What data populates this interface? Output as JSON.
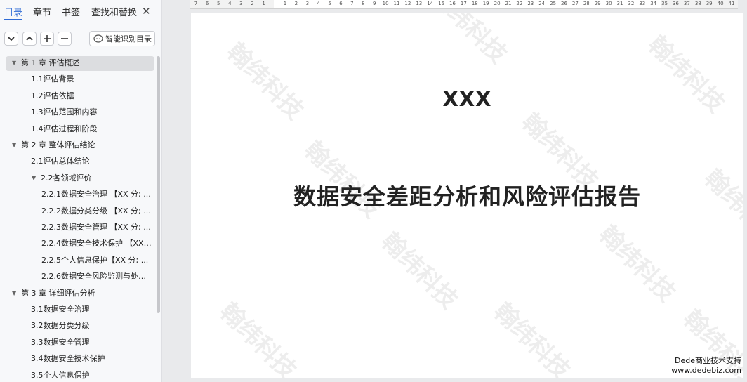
{
  "nav": {
    "tabs": [
      {
        "label": "目录",
        "active": true
      },
      {
        "label": "章节",
        "active": false
      },
      {
        "label": "书签",
        "active": false
      },
      {
        "label": "查找和替换",
        "active": false
      }
    ],
    "close_icon": "close-icon",
    "toolbar": {
      "collapse_icon": "chevron-down-icon",
      "expand_icon": "chevron-up-icon",
      "add_icon": "plus-icon",
      "remove_icon": "minus-icon",
      "smart_label": "智能识别目录"
    },
    "toc": [
      {
        "level": 1,
        "label": "第 1 章  评估概述",
        "collapsible": true,
        "selected": true
      },
      {
        "level": 2,
        "label": "1.1评估背景"
      },
      {
        "level": 2,
        "label": "1.2评估依据"
      },
      {
        "level": 2,
        "label": "1.3评估范围和内容"
      },
      {
        "level": 2,
        "label": "1.4评估过程和阶段"
      },
      {
        "level": 1,
        "label": "第 2 章  整体评估结论",
        "collapsible": true
      },
      {
        "level": 2,
        "label": "2.1评估总体结论"
      },
      {
        "level": 2,
        "label": "2.2各领域评价",
        "collapsible": true
      },
      {
        "level": 3,
        "label": "2.2.1数据安全治理 【XX 分; ..."
      },
      {
        "level": 3,
        "label": "2.2.2数据分类分级 【XX 分; ..."
      },
      {
        "level": 3,
        "label": "2.2.3数据安全管理 【XX 分; ..."
      },
      {
        "level": 3,
        "label": "2.2.4数据安全技术保护 【XX ..."
      },
      {
        "level": 3,
        "label": "2.2.5个人信息保护【XX 分; ..."
      },
      {
        "level": 3,
        "label": "2.2.6数据安全风险监测与处置..."
      },
      {
        "level": 1,
        "label": "第 3 章  详细评估分析",
        "collapsible": true
      },
      {
        "level": 2,
        "label": "3.1数据安全治理"
      },
      {
        "level": 2,
        "label": "3.2数据分类分级"
      },
      {
        "level": 2,
        "label": "3.3数据安全管理"
      },
      {
        "level": 2,
        "label": "3.4数据安全技术保护"
      },
      {
        "level": 2,
        "label": "3.5个人信息保护"
      }
    ]
  },
  "ruler": {
    "left_numbers": [
      "7",
      "6",
      "5",
      "4",
      "3",
      "2",
      "1"
    ],
    "right_numbers": [
      "1",
      "2",
      "3",
      "4",
      "5",
      "6",
      "7",
      "8",
      "9",
      "10",
      "11",
      "12",
      "13",
      "14",
      "15",
      "16",
      "17",
      "18",
      "19",
      "20",
      "21",
      "22",
      "23",
      "24",
      "25",
      "26",
      "27",
      "28",
      "29",
      "30",
      "31",
      "32",
      "33",
      "34",
      "35",
      "36",
      "37",
      "38",
      "39",
      "40",
      "41"
    ]
  },
  "document": {
    "subtitle": "XXX",
    "title": "数据安全差距分析和风险评估报告",
    "watermark": "翰纬科技"
  },
  "footer_badge": {
    "line1": "Dede商业技术支持",
    "line2": "www.dedebiz.com"
  }
}
